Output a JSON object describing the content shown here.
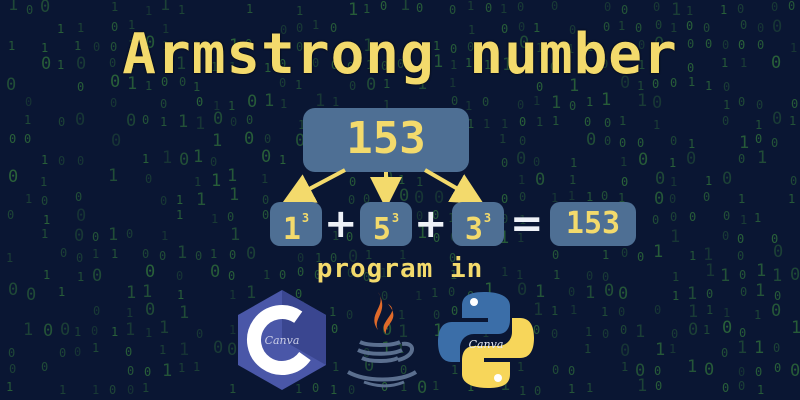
{
  "title": "Armstrong number",
  "number": "153",
  "equation": {
    "terms": [
      {
        "base": "1",
        "exp": "3"
      },
      {
        "base": "5",
        "exp": "3"
      },
      {
        "base": "3",
        "exp": "3"
      }
    ],
    "plus": "+",
    "equals": "=",
    "result": "153"
  },
  "subtitle": "program in",
  "languages": [
    {
      "name": "C",
      "icon": "c-language-icon",
      "watermark": "Canva"
    },
    {
      "name": "Java",
      "icon": "java-icon"
    },
    {
      "name": "Python",
      "icon": "python-icon",
      "watermark": "Canva"
    }
  ],
  "colors": {
    "background": "#0a1633",
    "matrix_digits": "#2e6b3a",
    "accent_yellow": "#f3da6c",
    "box_blue": "#4e6f94",
    "c_purple": "#4a57a8",
    "java_orange": "#e06a2a",
    "python_blue": "#3b6ea8",
    "python_yellow": "#f7d65a"
  }
}
